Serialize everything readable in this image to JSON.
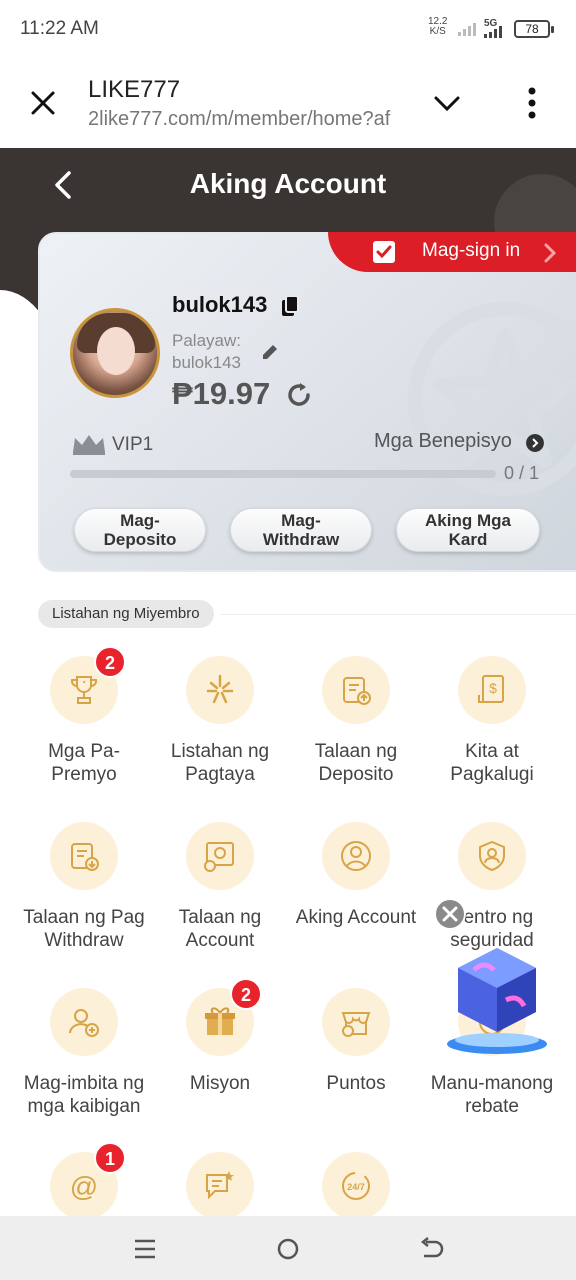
{
  "status_bar": {
    "time": "11:22 AM",
    "net_speed": "12.2",
    "net_unit": "K/S",
    "network": "5G",
    "battery": "78"
  },
  "browser": {
    "title": "LIKE777",
    "url": "2like777.com/m/member/home?af"
  },
  "header": {
    "title": "Aking Account"
  },
  "sign_in": {
    "label": "Mag-sign in"
  },
  "account": {
    "username": "bulok143",
    "nickname_label": "Palayaw:",
    "nickname": "bulok143",
    "balance": "₱19.97",
    "vip": "VIP1",
    "benefits": "Mga Benepisyo",
    "progress_text": "0 / 1",
    "progress": 0
  },
  "actions": {
    "deposit": "Mag-\nDeposito",
    "withdraw": "Mag-\nWithdraw",
    "cards": "Aking Mga\nKard"
  },
  "section": {
    "label": "Listahan ng Miyembro"
  },
  "menu": [
    {
      "label": "Mga Pa-\nPremyo",
      "icon": "trophy-icon",
      "badge": "2"
    },
    {
      "label": "Listahan ng\nPagtaya",
      "icon": "sparkle-icon",
      "badge": ""
    },
    {
      "label": "Talaan ng\nDeposito",
      "icon": "deposit-record-icon",
      "badge": ""
    },
    {
      "label": "Kita at\nPagkalugi",
      "icon": "profit-loss-icon",
      "badge": ""
    },
    {
      "label": "Talaan ng Pag\nWithdraw",
      "icon": "withdraw-record-icon",
      "badge": ""
    },
    {
      "label": "Talaan ng\nAccount",
      "icon": "account-record-icon",
      "badge": ""
    },
    {
      "label": "Aking Account",
      "icon": "user-icon",
      "badge": ""
    },
    {
      "label": "Sentro ng\nseguridad",
      "icon": "security-shield-icon",
      "badge": ""
    },
    {
      "label": "Mag-imbita ng\nmga kaibigan",
      "icon": "invite-friend-icon",
      "badge": ""
    },
    {
      "label": "Misyon",
      "icon": "gift-icon",
      "badge": "2"
    },
    {
      "label": "Puntos",
      "icon": "store-icon",
      "badge": ""
    },
    {
      "label": "Manu-manong\nrebate",
      "icon": "rebate-icon",
      "badge": ""
    },
    {
      "label": "",
      "icon": "email-icon",
      "badge": "1"
    },
    {
      "label": "",
      "icon": "feedback-icon",
      "badge": ""
    },
    {
      "label": "",
      "icon": "support-24-7-icon",
      "badge": ""
    }
  ],
  "colors": {
    "accent_red": "#dc1f26",
    "gold": "#d7a547",
    "icon_bg": "#fdf0d8",
    "header_dark": "#3a3533"
  }
}
